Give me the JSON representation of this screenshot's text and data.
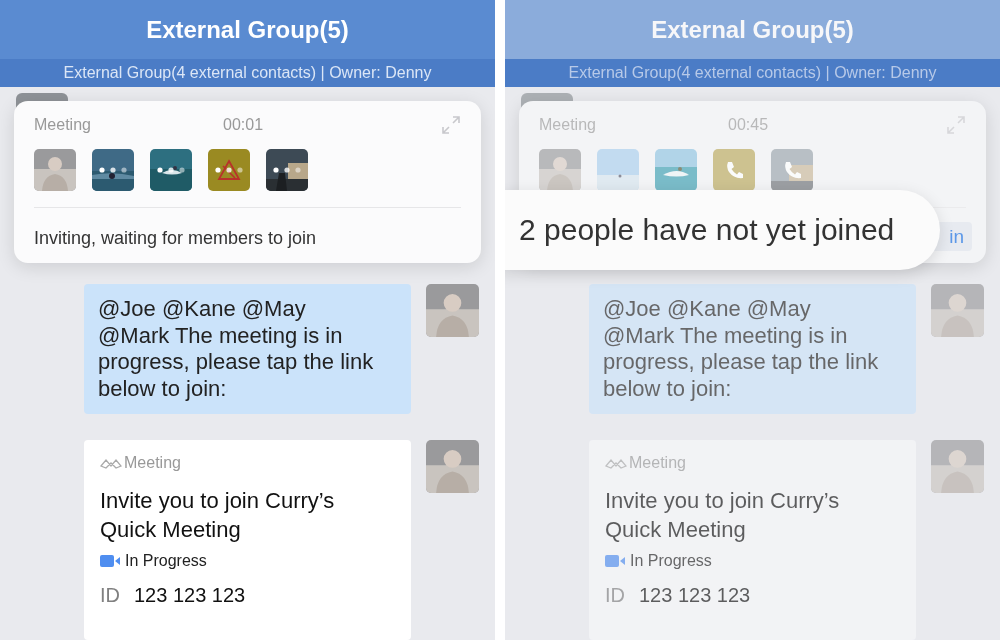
{
  "panels": [
    {
      "title": "External Group(5)",
      "subtitle": "External Group(4 external contacts) | Owner: Denny",
      "dimmed": false,
      "call": {
        "label": "Meeting",
        "timer": "00:01",
        "participants": [
          {
            "kind": "avatar",
            "connecting": false,
            "calling": false
          },
          {
            "kind": "video",
            "connecting": true,
            "calling": false
          },
          {
            "kind": "video",
            "connecting": true,
            "calling": false
          },
          {
            "kind": "placeholder",
            "connecting": true,
            "calling": false
          },
          {
            "kind": "video",
            "connecting": true,
            "calling": false
          }
        ],
        "status_text": "Inviting, waiting for members to join"
      },
      "message": "@Joe @Kane @May @Mark The meeting is in progress, please tap the link below to join:",
      "card": {
        "brand": "Meeting",
        "title": "Invite you to join Curry’s Quick Meeting",
        "state": "In Progress",
        "id_label": "ID",
        "id_value": "123 123 123"
      }
    },
    {
      "title": "External Group(5)",
      "subtitle": "External Group(4 external contacts) | Owner: Denny",
      "dimmed": true,
      "call": {
        "label": "Meeting",
        "timer": "00:45",
        "participants": [
          {
            "kind": "avatar",
            "connecting": false,
            "calling": false
          },
          {
            "kind": "video",
            "connecting": false,
            "calling": false
          },
          {
            "kind": "video",
            "connecting": false,
            "calling": false
          },
          {
            "kind": "placeholder",
            "connecting": false,
            "calling": true
          },
          {
            "kind": "video",
            "connecting": false,
            "calling": true
          }
        ],
        "join_button": "in"
      },
      "tooltip": "2 people have not yet joined",
      "message": "@Joe @Kane @May @Mark The meeting is in progress, please tap the link below to join:",
      "card": {
        "brand": "Meeting",
        "title": "Invite you to join Curry’s Quick Meeting",
        "state": "In Progress",
        "id_label": "ID",
        "id_value": "123 123 123"
      }
    }
  ]
}
